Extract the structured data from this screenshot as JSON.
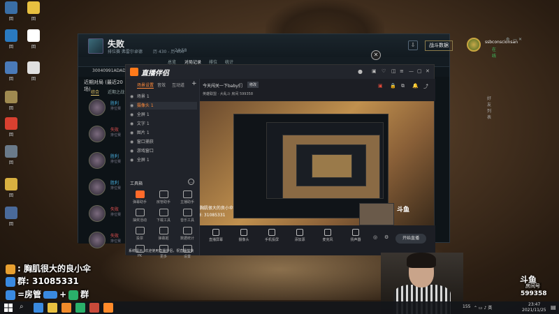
{
  "desktop": {
    "icons": [
      {
        "name": "desktop-icon-1",
        "label": "回",
        "color": "#3a6ea5"
      },
      {
        "name": "desktop-icon-2",
        "label": "回",
        "color": "#e8c040"
      },
      {
        "name": "desktop-icon-3",
        "label": "回",
        "color": "#2a7ac0"
      },
      {
        "name": "desktop-icon-4",
        "label": "回",
        "color": "#ffffff"
      },
      {
        "name": "desktop-icon-5",
        "label": "回",
        "color": "#4a7ab8"
      },
      {
        "name": "desktop-icon-6",
        "label": "回",
        "color": "#e0e0e0"
      },
      {
        "name": "desktop-icon-7",
        "label": "回",
        "color": "#a08a50"
      },
      {
        "name": "desktop-icon-8",
        "label": "回",
        "color": "#d84030"
      },
      {
        "name": "desktop-icon-9",
        "label": "回",
        "color": "#6a7a8a"
      },
      {
        "name": "desktop-icon-10",
        "label": "回",
        "color": "#d8b040"
      },
      {
        "name": "desktop-icon-11",
        "label": "回",
        "color": "#4a6a9a"
      }
    ]
  },
  "lol": {
    "title": "失败",
    "sub1": "排位赛 弗雷尔卓德",
    "sub2": "历 430 - 历 400",
    "sub3": "24:58",
    "data_button": "战斗数据",
    "user_name": "ssbconscionsan",
    "user_status": "在线",
    "friends_label": "好友列表",
    "nav": [
      "总览",
      "对局记录",
      "排位",
      "统计"
    ],
    "player_id": "30040991ADADADAD",
    "recent_label": "近期对局 (最近20场)",
    "tabs": [
      "综合",
      "近期之战"
    ],
    "matches": [
      {
        "result": "胜利",
        "mode": "排位赛",
        "win": true
      },
      {
        "result": "失败",
        "mode": "排位赛",
        "win": false
      },
      {
        "result": "胜利",
        "mode": "排位赛",
        "win": true
      },
      {
        "result": "胜利",
        "mode": "排位赛",
        "win": true
      },
      {
        "result": "失败",
        "mode": "排位赛",
        "win": false
      },
      {
        "result": "失败",
        "mode": "排位赛",
        "win": false
      }
    ]
  },
  "stream": {
    "app_name": "直播伴侣",
    "scene_tabs": [
      "场景设置",
      "音效",
      "互动道"
    ],
    "sources": [
      "场景 1",
      "摄像头 1",
      "全屏 1",
      "文字 1",
      "图片 1",
      "窗口捕获",
      "游戏窗口",
      "全屏 1"
    ],
    "tools_label": "工具箱",
    "tools": [
      "弹幕助手",
      "房管助手",
      "主播助手",
      "抽奖活动",
      "下载工具",
      "音乐工具",
      "投票",
      "弹幕姬",
      "数据统计",
      "PK",
      "更多",
      "设置"
    ],
    "room_title": "今天闯关一下baby们",
    "room_tag": "修改",
    "room_info": "英雄联盟 · 大乱斗  房间 599358",
    "bottom_buttons": [
      "直播屏幕",
      "摄像头",
      "手机投屏",
      "添加源",
      "麦克风",
      "扬声器"
    ],
    "go_live": "开始直播",
    "status_text": "系统提示: 欢迎使用直播伴侣，祝直播愉快"
  },
  "overlay": {
    "line1": ": 胸肌很大的良小伞",
    "line2": "群: 31085331",
    "line3": "=房管",
    "line3b": "群"
  },
  "douyu": {
    "logo": "斗鱼",
    "label": "房间号",
    "room": "599358"
  },
  "taskbar": {
    "tray": "155",
    "time": "23:47",
    "date": "2021/11/25",
    "apps": [
      "#3a8ae0",
      "#e8c040",
      "#f08a2a",
      "#2ab06a",
      "#c84a3a",
      "#ff8a2a"
    ]
  }
}
